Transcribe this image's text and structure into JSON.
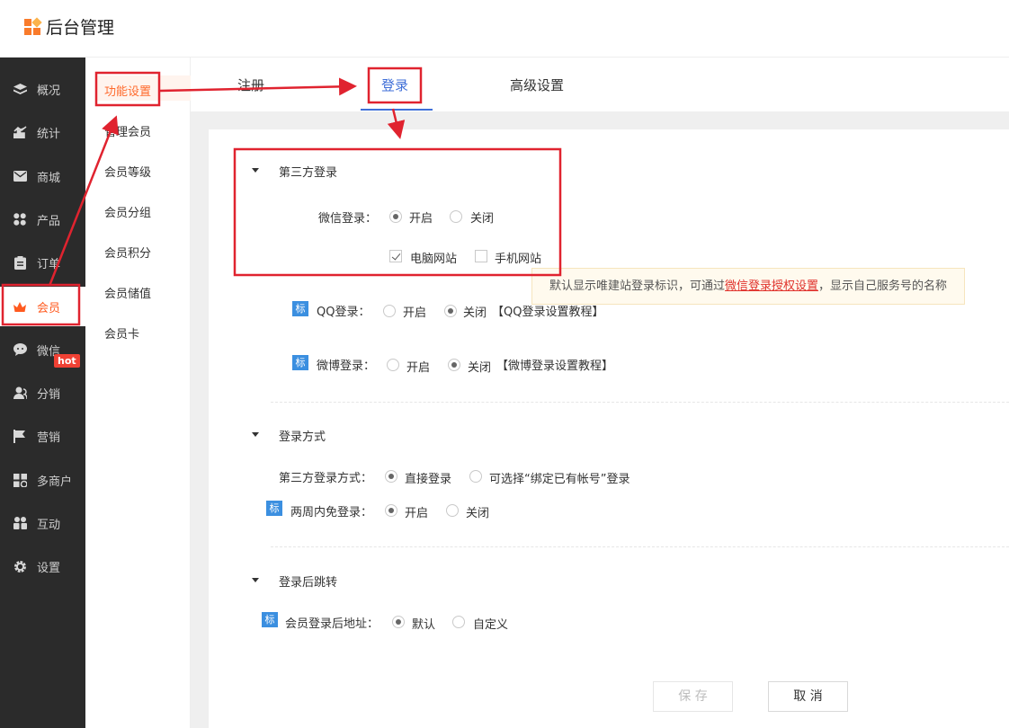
{
  "app": {
    "title": "后台管理"
  },
  "sidebar": {
    "items": [
      {
        "label": "概况",
        "icon": "layers-icon"
      },
      {
        "label": "统计",
        "icon": "chart-icon"
      },
      {
        "label": "商城",
        "icon": "mail-icon"
      },
      {
        "label": "产品",
        "icon": "grid-icon"
      },
      {
        "label": "订单",
        "icon": "clipboard-icon"
      },
      {
        "label": "会员",
        "icon": "crown-icon",
        "active": true
      },
      {
        "label": "微信",
        "icon": "chat-icon"
      },
      {
        "label": "分销",
        "icon": "user-icon"
      },
      {
        "label": "营销",
        "icon": "flag-icon"
      },
      {
        "label": "多商户",
        "icon": "store-icon"
      },
      {
        "label": "互动",
        "icon": "interact-icon"
      },
      {
        "label": "设置",
        "icon": "gear-icon"
      }
    ],
    "hot_badge": "hot"
  },
  "subnav": {
    "items": [
      "功能设置",
      "管理会员",
      "会员等级",
      "会员分组",
      "会员积分",
      "会员储值",
      "会员卡"
    ]
  },
  "tabs": [
    "注册",
    "登录",
    "高级设置"
  ],
  "third_party": {
    "title": "第三方登录",
    "wechat": {
      "label": "微信登录：",
      "on": "开启",
      "off": "关闭",
      "selected": "开启",
      "pc": "电脑网站",
      "mobile": "手机网站"
    },
    "tip": {
      "prefix": "默认显示唯建站登录标识，可通过",
      "link": "微信登录授权设置",
      "suffix": "，显示自己服务号的名称"
    },
    "qq": {
      "tag": "标",
      "label": "QQ登录：",
      "on": "开启",
      "off": "关闭",
      "selected": "关闭",
      "tutorial": "【QQ登录设置教程】"
    },
    "weibo": {
      "tag": "标",
      "label": "微博登录：",
      "on": "开启",
      "off": "关闭",
      "selected": "关闭",
      "tutorial": "【微博登录设置教程】"
    }
  },
  "login_method": {
    "title": "登录方式",
    "third_label": "第三方登录方式：",
    "direct": "直接登录",
    "bind": "可选择“绑定已有帐号”登录",
    "tag": "标",
    "twoweek_label": "两周内免登录：",
    "on": "开启",
    "off": "关闭"
  },
  "redirect": {
    "title": "登录后跳转",
    "tag": "标",
    "label": "会员登录后地址：",
    "default": "默认",
    "custom": "自定义"
  },
  "buttons": {
    "save": "保 存",
    "cancel": "取 消"
  },
  "colors": {
    "accent": "#ff5a1f",
    "link": "#3f6fd8",
    "annotation": "#e0232f"
  }
}
